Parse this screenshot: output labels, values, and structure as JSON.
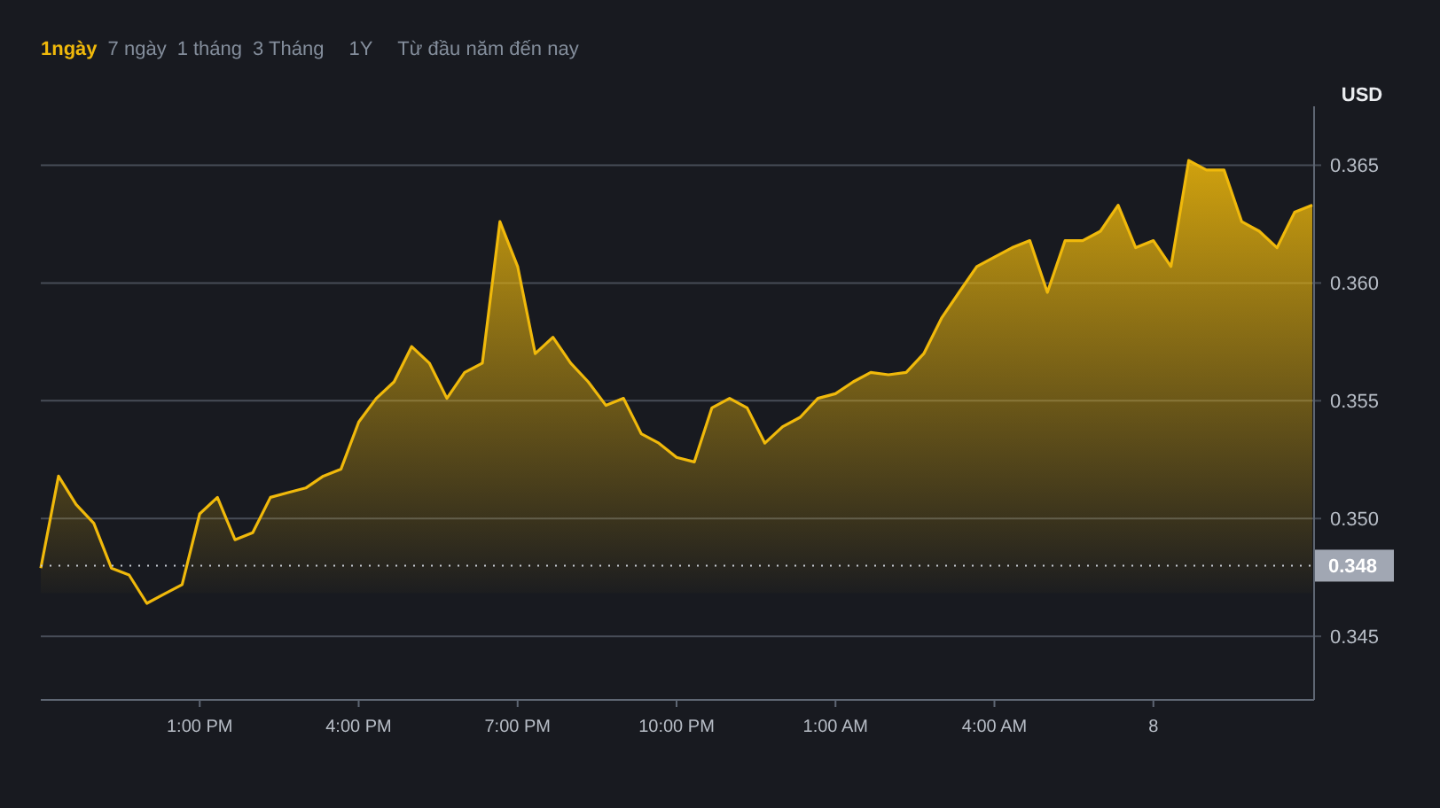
{
  "tabs": [
    {
      "label": "1ngày",
      "selected": true
    },
    {
      "label": "7 ngày",
      "selected": false
    },
    {
      "label": "1 tháng",
      "selected": false
    },
    {
      "label": "3 Tháng",
      "selected": false
    },
    {
      "label": "1Y",
      "selected": false
    },
    {
      "label": "Từ đầu năm đến nay",
      "selected": false
    }
  ],
  "chart": {
    "unit": "USD",
    "chart_data": {
      "type": "area",
      "categories": [
        null,
        null,
        null,
        null,
        null,
        null,
        null,
        null,
        null,
        "1:00 PM",
        null,
        null,
        null,
        null,
        null,
        null,
        null,
        null,
        "4:00 PM",
        null,
        null,
        null,
        null,
        null,
        null,
        null,
        null,
        "7:00 PM",
        null,
        null,
        null,
        null,
        null,
        null,
        null,
        null,
        "10:00 PM",
        null,
        null,
        null,
        null,
        null,
        null,
        null,
        null,
        "1:00 AM",
        null,
        null,
        null,
        null,
        null,
        null,
        null,
        null,
        "4:00 AM",
        null,
        null,
        null,
        null,
        null,
        null,
        null,
        null,
        "8",
        null,
        null,
        null,
        null,
        null,
        null,
        null,
        null,
        null
      ],
      "series": [
        {
          "color": "#f0b90b",
          "values": [
            0.3479,
            0.3518,
            0.3506,
            0.3498,
            0.3479,
            0.3476,
            0.3464,
            0.3468,
            0.3472,
            0.3502,
            0.3509,
            0.3491,
            0.3494,
            0.3509,
            0.3511,
            0.3513,
            0.3518,
            0.3521,
            0.3541,
            0.3551,
            0.3558,
            0.3573,
            0.3566,
            0.3551,
            0.3562,
            0.3566,
            0.3626,
            0.3607,
            0.357,
            0.3577,
            0.3566,
            0.3558,
            0.3548,
            0.3551,
            0.3536,
            0.3532,
            0.3526,
            0.3524,
            0.3547,
            0.3551,
            0.3547,
            0.3532,
            0.3539,
            0.3543,
            0.3551,
            0.3553,
            0.3558,
            0.3562,
            0.3561,
            0.3562,
            0.357,
            0.3585,
            0.3596,
            0.3607,
            0.3611,
            0.3615,
            0.3618,
            0.3596,
            0.3618,
            0.3618,
            0.3622,
            0.3633,
            0.3615,
            0.3618,
            0.3607,
            0.3652,
            0.3648,
            0.3648,
            0.3626,
            0.3622,
            0.3615,
            0.363,
            0.3633
          ]
        }
      ],
      "ylim": [
        0.3423,
        0.3675
      ],
      "grid": true,
      "ref_lines": [
        {
          "axis": "y",
          "value": 0.348,
          "label": "0.348"
        }
      ],
      "yticks": [
        {
          "value": 0.345,
          "label": "0.345"
        },
        {
          "value": 0.35,
          "label": "0.350"
        },
        {
          "value": 0.355,
          "label": "0.355"
        },
        {
          "value": 0.36,
          "label": "0.360"
        },
        {
          "value": 0.365,
          "label": "0.365"
        }
      ]
    }
  }
}
